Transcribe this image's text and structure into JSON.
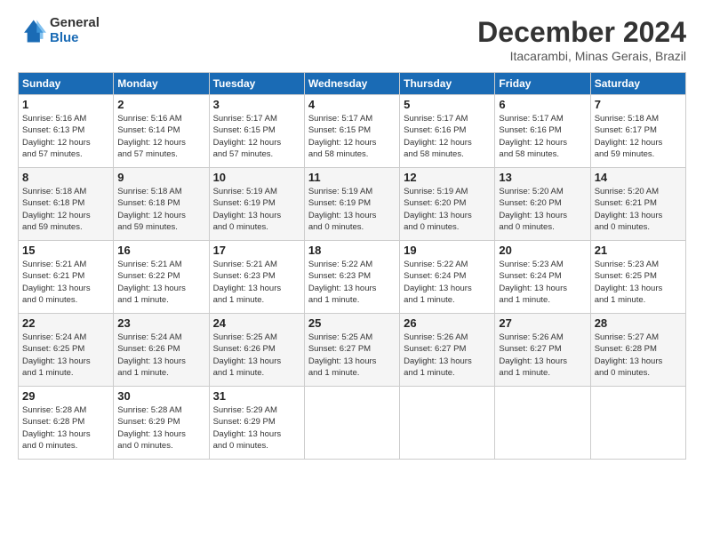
{
  "header": {
    "logo_general": "General",
    "logo_blue": "Blue",
    "month_title": "December 2024",
    "subtitle": "Itacarambi, Minas Gerais, Brazil"
  },
  "days_of_week": [
    "Sunday",
    "Monday",
    "Tuesday",
    "Wednesday",
    "Thursday",
    "Friday",
    "Saturday"
  ],
  "weeks": [
    [
      {
        "num": "1",
        "info": "Sunrise: 5:16 AM\nSunset: 6:13 PM\nDaylight: 12 hours\nand 57 minutes."
      },
      {
        "num": "2",
        "info": "Sunrise: 5:16 AM\nSunset: 6:14 PM\nDaylight: 12 hours\nand 57 minutes."
      },
      {
        "num": "3",
        "info": "Sunrise: 5:17 AM\nSunset: 6:15 PM\nDaylight: 12 hours\nand 57 minutes."
      },
      {
        "num": "4",
        "info": "Sunrise: 5:17 AM\nSunset: 6:15 PM\nDaylight: 12 hours\nand 58 minutes."
      },
      {
        "num": "5",
        "info": "Sunrise: 5:17 AM\nSunset: 6:16 PM\nDaylight: 12 hours\nand 58 minutes."
      },
      {
        "num": "6",
        "info": "Sunrise: 5:17 AM\nSunset: 6:16 PM\nDaylight: 12 hours\nand 58 minutes."
      },
      {
        "num": "7",
        "info": "Sunrise: 5:18 AM\nSunset: 6:17 PM\nDaylight: 12 hours\nand 59 minutes."
      }
    ],
    [
      {
        "num": "8",
        "info": "Sunrise: 5:18 AM\nSunset: 6:18 PM\nDaylight: 12 hours\nand 59 minutes."
      },
      {
        "num": "9",
        "info": "Sunrise: 5:18 AM\nSunset: 6:18 PM\nDaylight: 12 hours\nand 59 minutes."
      },
      {
        "num": "10",
        "info": "Sunrise: 5:19 AM\nSunset: 6:19 PM\nDaylight: 13 hours\nand 0 minutes."
      },
      {
        "num": "11",
        "info": "Sunrise: 5:19 AM\nSunset: 6:19 PM\nDaylight: 13 hours\nand 0 minutes."
      },
      {
        "num": "12",
        "info": "Sunrise: 5:19 AM\nSunset: 6:20 PM\nDaylight: 13 hours\nand 0 minutes."
      },
      {
        "num": "13",
        "info": "Sunrise: 5:20 AM\nSunset: 6:20 PM\nDaylight: 13 hours\nand 0 minutes."
      },
      {
        "num": "14",
        "info": "Sunrise: 5:20 AM\nSunset: 6:21 PM\nDaylight: 13 hours\nand 0 minutes."
      }
    ],
    [
      {
        "num": "15",
        "info": "Sunrise: 5:21 AM\nSunset: 6:21 PM\nDaylight: 13 hours\nand 0 minutes."
      },
      {
        "num": "16",
        "info": "Sunrise: 5:21 AM\nSunset: 6:22 PM\nDaylight: 13 hours\nand 1 minute."
      },
      {
        "num": "17",
        "info": "Sunrise: 5:21 AM\nSunset: 6:23 PM\nDaylight: 13 hours\nand 1 minute."
      },
      {
        "num": "18",
        "info": "Sunrise: 5:22 AM\nSunset: 6:23 PM\nDaylight: 13 hours\nand 1 minute."
      },
      {
        "num": "19",
        "info": "Sunrise: 5:22 AM\nSunset: 6:24 PM\nDaylight: 13 hours\nand 1 minute."
      },
      {
        "num": "20",
        "info": "Sunrise: 5:23 AM\nSunset: 6:24 PM\nDaylight: 13 hours\nand 1 minute."
      },
      {
        "num": "21",
        "info": "Sunrise: 5:23 AM\nSunset: 6:25 PM\nDaylight: 13 hours\nand 1 minute."
      }
    ],
    [
      {
        "num": "22",
        "info": "Sunrise: 5:24 AM\nSunset: 6:25 PM\nDaylight: 13 hours\nand 1 minute."
      },
      {
        "num": "23",
        "info": "Sunrise: 5:24 AM\nSunset: 6:26 PM\nDaylight: 13 hours\nand 1 minute."
      },
      {
        "num": "24",
        "info": "Sunrise: 5:25 AM\nSunset: 6:26 PM\nDaylight: 13 hours\nand 1 minute."
      },
      {
        "num": "25",
        "info": "Sunrise: 5:25 AM\nSunset: 6:27 PM\nDaylight: 13 hours\nand 1 minute."
      },
      {
        "num": "26",
        "info": "Sunrise: 5:26 AM\nSunset: 6:27 PM\nDaylight: 13 hours\nand 1 minute."
      },
      {
        "num": "27",
        "info": "Sunrise: 5:26 AM\nSunset: 6:27 PM\nDaylight: 13 hours\nand 1 minute."
      },
      {
        "num": "28",
        "info": "Sunrise: 5:27 AM\nSunset: 6:28 PM\nDaylight: 13 hours\nand 0 minutes."
      }
    ],
    [
      {
        "num": "29",
        "info": "Sunrise: 5:28 AM\nSunset: 6:28 PM\nDaylight: 13 hours\nand 0 minutes."
      },
      {
        "num": "30",
        "info": "Sunrise: 5:28 AM\nSunset: 6:29 PM\nDaylight: 13 hours\nand 0 minutes."
      },
      {
        "num": "31",
        "info": "Sunrise: 5:29 AM\nSunset: 6:29 PM\nDaylight: 13 hours\nand 0 minutes."
      },
      null,
      null,
      null,
      null
    ]
  ]
}
